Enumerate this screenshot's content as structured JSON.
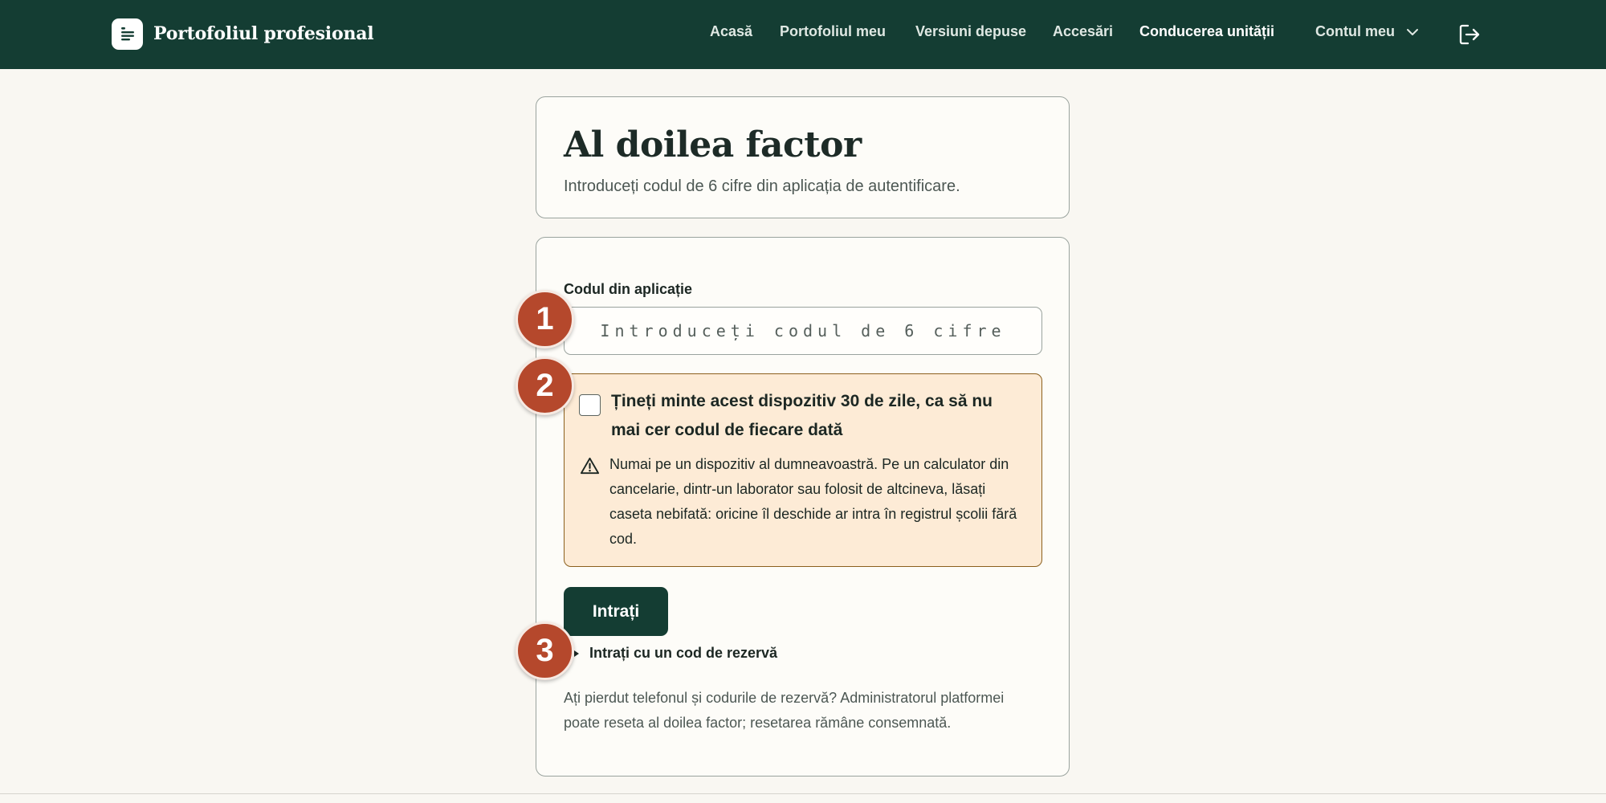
{
  "app": {
    "brand_name": "Portofoliul profesional",
    "brand_icon": "document-lines-icon"
  },
  "nav": {
    "items": [
      {
        "label": "Acasă",
        "active": false
      },
      {
        "label": "Portofoliul meu",
        "active": false
      },
      {
        "label": "Versiuni depuse",
        "active": false
      },
      {
        "label": "Accesări",
        "active": false
      },
      {
        "label": "Conducerea unității",
        "active": true
      }
    ],
    "account_label": "Contul meu",
    "account_icon": "chevron-down-icon",
    "logout_icon": "logout-icon"
  },
  "header_card": {
    "title": "Al doilea factor",
    "subtitle": "Introduceți codul de 6 cifre din aplicația de autentificare."
  },
  "form": {
    "code_label": "Codul din aplicație",
    "code_placeholder": "Introduceți codul de 6 cifre",
    "code_value": "",
    "remember_checked": false,
    "remember_label": "Țineți minte acest dispozitiv 30 de zile, ca să nu mai cer codul de fiecare dată",
    "warning_icon": "warning-triangle-icon",
    "warning_text": "Numai pe un dispozitiv al dumneavoastră. Pe un calculator din cancelarie, dintr-un laborator sau folosit de altcineva, lăsați caseta nebifată: oricine îl deschide ar intra în registrul școlii fără cod.",
    "submit_label": "Intrați",
    "backup_label": "Intrați cu un cod de rezervă",
    "help_text": "Ați pierdut telefonul și codurile de rezervă? Administratorul platformei poate reseta al doilea factor; resetarea rămâne consemnată."
  },
  "markers": [
    "1",
    "2",
    "3"
  ],
  "colors": {
    "topbar": "#143d33",
    "page_background": "#f9f7f2",
    "primary_button": "#143d33",
    "warning_background": "#fdebd6",
    "warning_border": "#8b5f1d",
    "marker": "#b5482c"
  }
}
